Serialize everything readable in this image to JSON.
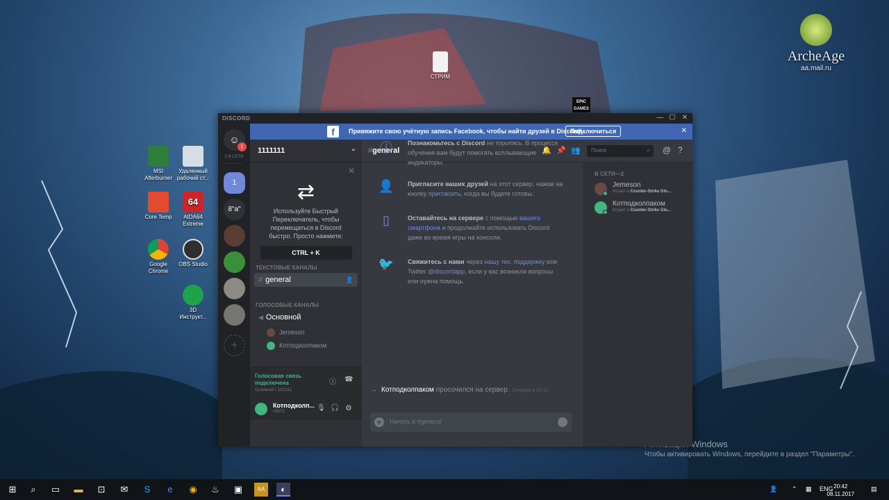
{
  "desktop": {
    "icons": [
      {
        "label": "MSI Afterburner"
      },
      {
        "label": "Удаленный рабочий ст..."
      },
      {
        "label": "Core Temp"
      },
      {
        "label": "AIDA64 Extreme"
      },
      {
        "label": "Google Chrome"
      },
      {
        "label": "OBS Studio"
      },
      {
        "label": "3D Инструкт..."
      },
      {
        "label": "СТРИМ"
      },
      {
        "label": "EPIC GAMES"
      }
    ],
    "archeage": {
      "title": "ArcheAge",
      "url": "aa.mail.ru"
    },
    "activation": {
      "line1": "Активация Windows",
      "line2": "Чтобы активировать Windows, перейдите в раздел \"Параметры\"."
    }
  },
  "discord": {
    "brand": "DISCORD",
    "window_controls": {
      "minimize": "—",
      "maximize": "☐",
      "close": "✕"
    },
    "facebook_banner": {
      "text": "Привяжите свою учётную запись Facebook, чтобы найти друзей в Discord!",
      "button": "Подключиться",
      "close": "✕"
    },
    "guilds": {
      "friends_online": "2 В СЕТИ",
      "badge": "1",
      "items": [
        {
          "label": "1"
        },
        {
          "label": "8\"a\""
        }
      ],
      "add": "+"
    },
    "server": {
      "name": "1111111",
      "tip": {
        "text": "Используйте Быстрый Переключатель, чтобы перемещаться в Discord быстро. Просто нажмите:",
        "key": "CTRL + K"
      },
      "text_category": "ТЕКСТОВЫЕ КАНАЛЫ",
      "text_channel": "general",
      "voice_category": "ГОЛОСОВЫЕ КАНАЛЫ",
      "voice_channel": "Основной",
      "voice_users": [
        "Jemeson",
        "Котподколпаком"
      ]
    },
    "voice_status": {
      "title": "Голосовая связь подключена",
      "sub": "Основной / 1111111"
    },
    "user": {
      "name": "Котподколп...",
      "tag": "#5572"
    },
    "chat": {
      "channel": "general",
      "welcome": [
        {
          "bold": "Познакомьтесь с Discord",
          "text": " не торопясь. В процессе обучения вам будут помогать всплывающие индикаторы."
        },
        {
          "bold": "Пригласите ваших друзей",
          "text1": " на этот сервер, нажав на кнопку ",
          "link": "пригласить",
          "text2": ", когда вы будете готовы."
        },
        {
          "bold": "Оставайтесь на сервере",
          "text1": " с помощью ",
          "link": "вашего смартфона",
          "text2": " и продолжайте использовать Discord даже во время игры на консоли."
        },
        {
          "bold": "Свяжитесь с нами",
          "text1": " через ",
          "link": "нашу тех. поддержку",
          "text2": " или Twitter ",
          "link2": "@discordapp",
          "text3": ", если у вас возникли вопросы или нужна помощь."
        }
      ],
      "join": {
        "user": "Котподколпаком",
        "text": " просочился на сервер.",
        "time": "Сегодня в 20:12"
      },
      "input_placeholder": "Начать в #general"
    },
    "toolbar": {
      "search_placeholder": "Поиск"
    },
    "members": {
      "header": "В СЕТИ—2",
      "list": [
        {
          "name": "Jemeson",
          "activity_prefix": "Играет в ",
          "game": "Counter-Strike Glo..."
        },
        {
          "name": "Котподколпаком",
          "activity_prefix": "Играет в ",
          "game": "Counter-Strike Glo..."
        }
      ]
    }
  },
  "taskbar": {
    "lang": "ENG",
    "time": "20:42",
    "date": "08.11.2017"
  }
}
